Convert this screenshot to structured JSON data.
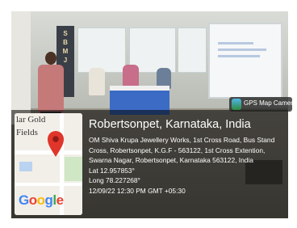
{
  "photo": {
    "banner_letters": [
      "S",
      "B",
      "M",
      "J"
    ]
  },
  "gps_badge": {
    "label": "GPS Map Camera"
  },
  "map": {
    "label_line1": "lar Gold",
    "label_line2": "Fields",
    "logo": "Google"
  },
  "location": {
    "title": "Robertsonpet, Karnataka, India",
    "address_line1": "OM Shiva Krupa Jewellery Works, 1st Cross Road, Bus Stand",
    "address_line2": "Cross, Robertsonpet, K.G.F - 563122, 1st Cross Extention,",
    "address_line3": "Swarna Nagar, Robertsonpet, Karnataka 563122, India",
    "lat": "Lat 12.957853°",
    "long": "Long 78.227268°",
    "datetime": "12/09/22 12:30 PM GMT +05:30"
  }
}
